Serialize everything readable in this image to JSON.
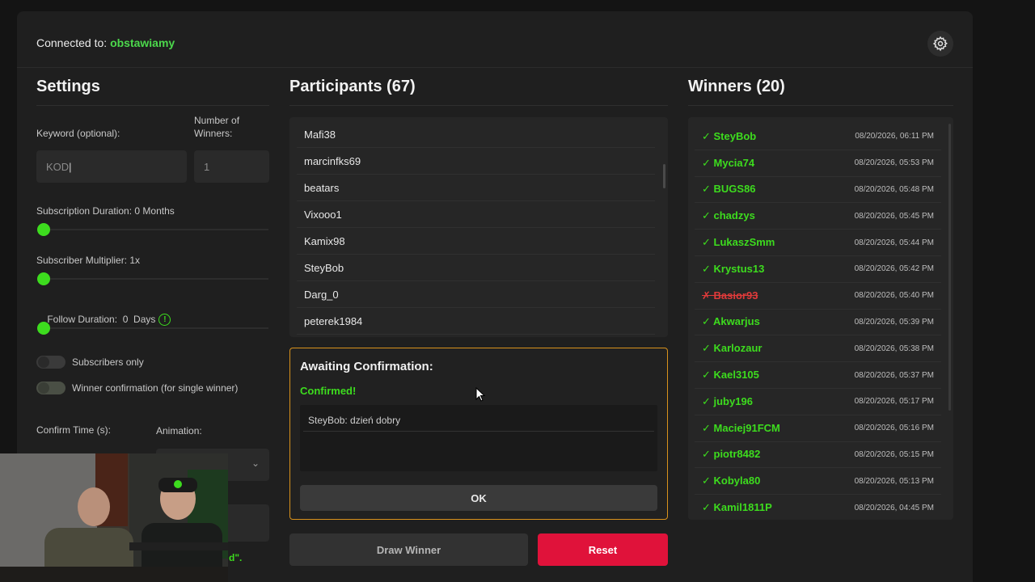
{
  "header": {
    "connected_label": "Connected to:",
    "channel": "obstawiamy"
  },
  "settings": {
    "title": "Settings",
    "keyword_label": "Keyword (optional):",
    "keyword_value": "KOD",
    "winners_label_1": "Number of",
    "winners_label_2": "Winners:",
    "winners_value": "1",
    "sub_duration_label": "Subscription Duration: 0 Months",
    "sub_multiplier_label": "Subscriber Multiplier: 1x",
    "follow_duration_label": "Follow Duration:  0  Days",
    "subscribers_only_label": "Subscribers only",
    "winner_confirmation_label": "Winner confirmation (for single winner)",
    "confirm_time_label": "Confirm Time (s):",
    "animation_label": "Animation:",
    "partial_text": "d\"."
  },
  "participants": {
    "title": "Participants (67)",
    "items": [
      "Mafi38",
      "marcinfks69",
      "beatars",
      "Vixooo1",
      "Kamix98",
      "SteyBob",
      "Darg_0",
      "peterek1984"
    ]
  },
  "awaiting": {
    "title": "Awaiting Confirmation:",
    "status": "Confirmed!",
    "message": "SteyBob: dzień dobry",
    "ok_label": "OK"
  },
  "actions": {
    "draw_label": "Draw Winner",
    "reset_label": "Reset"
  },
  "winners": {
    "title": "Winners (20)",
    "items": [
      {
        "name": "✓ SteyBob",
        "time": "08/20/2026, 06:11 PM",
        "confirmed": true
      },
      {
        "name": "✓ Mycia74",
        "time": "08/20/2026, 05:53 PM",
        "confirmed": true
      },
      {
        "name": "✓ BUGS86",
        "time": "08/20/2026, 05:48 PM",
        "confirmed": true
      },
      {
        "name": "✓ chadzys",
        "time": "08/20/2026, 05:45 PM",
        "confirmed": true
      },
      {
        "name": "✓ LukaszSmm",
        "time": "08/20/2026, 05:44 PM",
        "confirmed": true
      },
      {
        "name": "✓ Krystus13",
        "time": "08/20/2026, 05:42 PM",
        "confirmed": true
      },
      {
        "name": "✗ Basior93",
        "time": "08/20/2026, 05:40 PM",
        "confirmed": false
      },
      {
        "name": "✓ Akwarjus",
        "time": "08/20/2026, 05:39 PM",
        "confirmed": true
      },
      {
        "name": "✓ Karlozaur",
        "time": "08/20/2026, 05:38 PM",
        "confirmed": true
      },
      {
        "name": "✓ Kael3105",
        "time": "08/20/2026, 05:37 PM",
        "confirmed": true
      },
      {
        "name": "✓ juby196",
        "time": "08/20/2026, 05:17 PM",
        "confirmed": true
      },
      {
        "name": "✓ Maciej91FCM",
        "time": "08/20/2026, 05:16 PM",
        "confirmed": true
      },
      {
        "name": "✓ piotr8482",
        "time": "08/20/2026, 05:15 PM",
        "confirmed": true
      },
      {
        "name": "✓ Kobyla80",
        "time": "08/20/2026, 05:13 PM",
        "confirmed": true
      },
      {
        "name": "✓ Kamil1811P",
        "time": "08/20/2026, 04:45 PM",
        "confirmed": true
      }
    ]
  },
  "colors": {
    "accent": "#3ddc1e",
    "danger": "#e0123a",
    "warning_border": "#d9921c"
  }
}
